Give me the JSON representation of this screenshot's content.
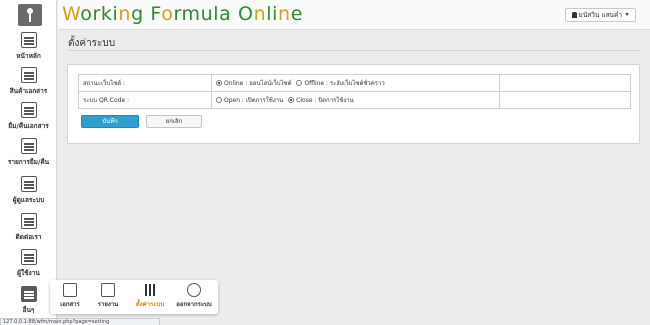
{
  "brand": {
    "part1": "W",
    "part2": "orki",
    "part3": "n",
    "part4": "g F",
    "part5": "o",
    "part6": "rmula O",
    "part7": "n",
    "part8": "li",
    "part9": "n",
    "part10": "e"
  },
  "header": {
    "user_label": "มนัสวิน แสนคำ"
  },
  "sidebar": {
    "items": [
      {
        "label": "หน้าหลัก",
        "icon": "monitor-icon"
      },
      {
        "label": "สินค้าเอกสาร",
        "icon": "documents-icon"
      },
      {
        "label": "ยืม/คืนเอกสาร",
        "icon": "exchange-icon"
      },
      {
        "label": "รายการยืม/คืน",
        "icon": "list-icon"
      },
      {
        "label": "ผู้ดูแลระบบ",
        "icon": "admin-icon"
      },
      {
        "label": "ติดต่อเรา",
        "icon": "contact-icon"
      },
      {
        "label": "ผู้ใช้งาน",
        "icon": "users-icon"
      },
      {
        "label": "อื่นๆ",
        "icon": "more-icon"
      }
    ]
  },
  "page": {
    "title": "ตั้งค่าระบบ"
  },
  "settings": {
    "rows": [
      {
        "label": "สถานะเว็บไซต์ :",
        "options": [
          {
            "text": "Online : ออนไลน์เว็บไซต์",
            "selected": true
          },
          {
            "text": "Offline : ระงับเว็บไซต์ชั่วคราว",
            "selected": false
          }
        ]
      },
      {
        "label": "ระบบ QR Code :",
        "options": [
          {
            "text": "Open : เปิดการใช้งาน",
            "selected": false
          },
          {
            "text": "Close : ปิดการใช้งาน",
            "selected": true
          }
        ]
      }
    ],
    "save_label": "บันทึก",
    "cancel_label": "ยกเลิก"
  },
  "popup": {
    "items": [
      {
        "label": "เอกสาร",
        "icon": "document-icon",
        "active": false
      },
      {
        "label": "รายงาน",
        "icon": "report-icon",
        "active": false
      },
      {
        "label": "ตั้งค่าระบบ",
        "icon": "settings-sliders-icon",
        "active": true
      },
      {
        "label": "ออกจากระบบ",
        "icon": "logout-lock-icon",
        "active": false
      }
    ]
  },
  "status_bar": {
    "url": "127.0.0.1:88/wfm/main.php?page=setting"
  },
  "colors": {
    "brand_green": "#2e8b2e",
    "brand_gold": "#d4a017",
    "primary_button": "#2e9fd0",
    "active_menu": "#d48a00"
  }
}
